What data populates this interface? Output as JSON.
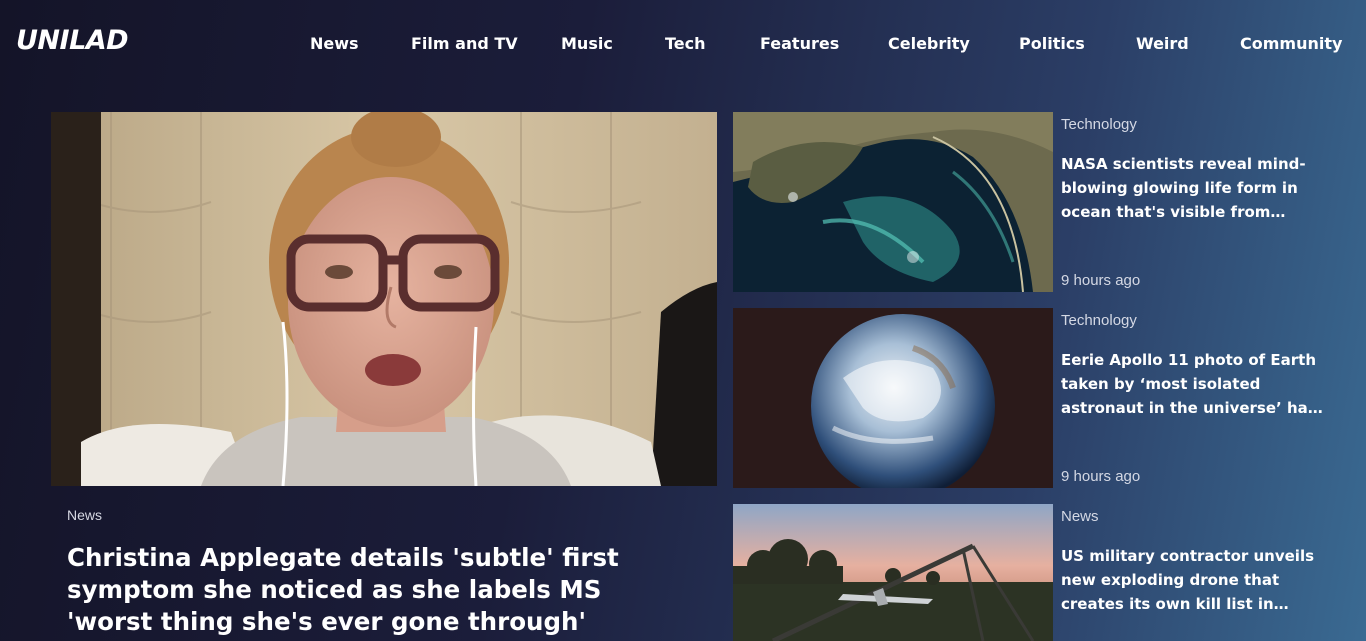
{
  "header": {
    "logo": "UNILAD",
    "nav": [
      "News",
      "Film and TV",
      "Music",
      "Tech",
      "Features",
      "Celebrity",
      "Politics",
      "Weird",
      "Community"
    ]
  },
  "hero": {
    "category": "News",
    "title": "Christina Applegate details 'subtle' first symptom she noticed as she labels MS 'worst thing she's ever gone through'"
  },
  "articles": [
    {
      "category": "Technology",
      "title": "NASA scientists reveal mind-blowing glowing life form in ocean that's visible from…",
      "time": "9 hours ago"
    },
    {
      "category": "Technology",
      "title": "Eerie Apollo 11 photo of Earth taken by ‘most isolated astronaut in the universe’ ha…",
      "time": "9 hours ago"
    },
    {
      "category": "News",
      "title": "US military contractor unveils new exploding drone that creates its own kill list in…"
    }
  ],
  "colors": {
    "background_start": "#141428",
    "background_end": "#3a6a92",
    "text": "#ffffff",
    "muted_text": "#d4d8e4"
  }
}
